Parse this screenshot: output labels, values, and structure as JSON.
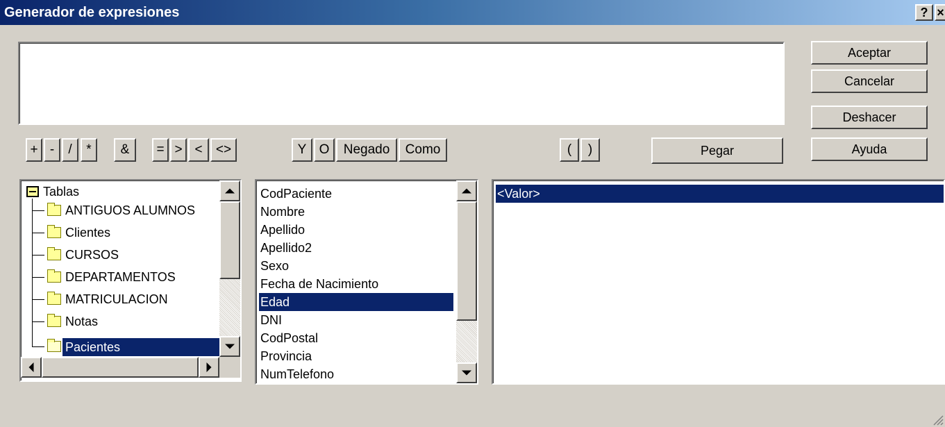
{
  "window": {
    "title": "Generador de expresiones",
    "help_label": "?",
    "close_label": "×"
  },
  "buttons": {
    "accept": "Aceptar",
    "cancel": "Cancelar",
    "undo": "Deshacer",
    "help": "Ayuda",
    "paste": "Pegar"
  },
  "expression": {
    "value": ""
  },
  "operators": {
    "plus": "+",
    "minus": "-",
    "divide": "/",
    "multiply": "*",
    "concat": "&",
    "equal": "=",
    "greater": ">",
    "less": "<",
    "notequal": "<>",
    "and": "Y",
    "or": "O",
    "not": "Negado",
    "like": "Como",
    "open_paren": "(",
    "close_paren": ")"
  },
  "tree": {
    "root": "Tablas",
    "items": [
      "ANTIGUOS ALUMNOS",
      "Clientes",
      "CURSOS",
      "DEPARTAMENTOS",
      "MATRICULACION",
      "Notas",
      "Pacientes"
    ],
    "selected": "Pacientes"
  },
  "fields": {
    "items": [
      "CodPaciente",
      "Nombre",
      "Apellido",
      "Apellido2",
      "Sexo",
      "Fecha de Nacimiento",
      "Edad",
      "DNI",
      "CodPostal",
      "Provincia",
      "NumTelefono"
    ],
    "selected": "Edad"
  },
  "values": {
    "items": [
      "<Valor>"
    ],
    "selected": "<Valor>"
  },
  "colors": {
    "selection": "#0a246a",
    "face": "#d4d0c8",
    "title_start": "#0a246a"
  }
}
